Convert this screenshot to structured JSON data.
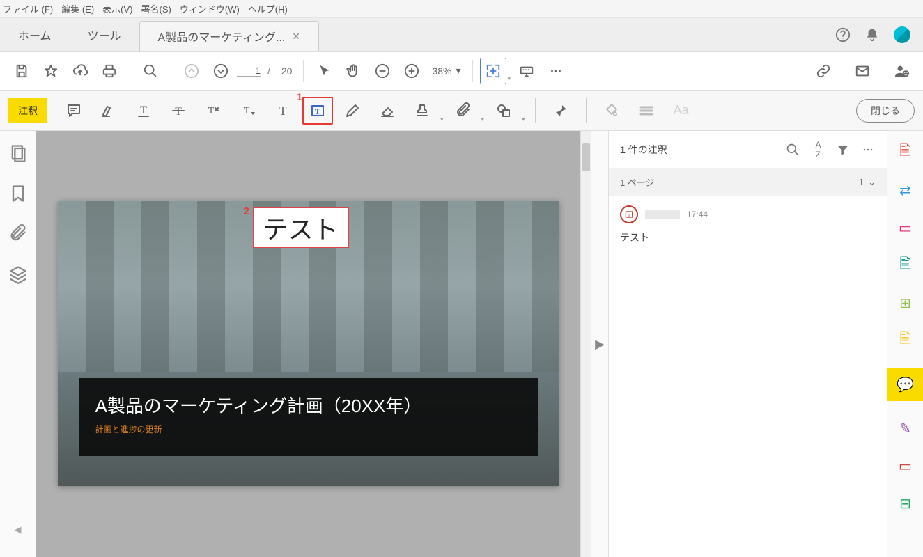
{
  "menu": {
    "file": "ファイル (F)",
    "edit": "編集 (E)",
    "view": "表示(V)",
    "sign": "署名(S)",
    "window": "ウィンドウ(W)",
    "help": "ヘルプ(H)"
  },
  "tabs": {
    "home": "ホーム",
    "tools": "ツール",
    "document": "A製品のマーケティング..."
  },
  "toolbar": {
    "current_page": "1",
    "page_sep": "/",
    "total_pages": "20",
    "zoom": "38%"
  },
  "annobar": {
    "label": "注釈",
    "close": "閉じる",
    "callout1": "1"
  },
  "document": {
    "title": "A製品のマーケティング計画（20XX年）",
    "subtitle": "計画と進捗の更新",
    "annotation_text": "テスト",
    "callout2": "2"
  },
  "comments": {
    "header_count": "1",
    "header_suffix": "件の注釈",
    "section_label": "1 ページ",
    "section_count": "1",
    "item_time": "17:44",
    "item_text": "テスト"
  }
}
